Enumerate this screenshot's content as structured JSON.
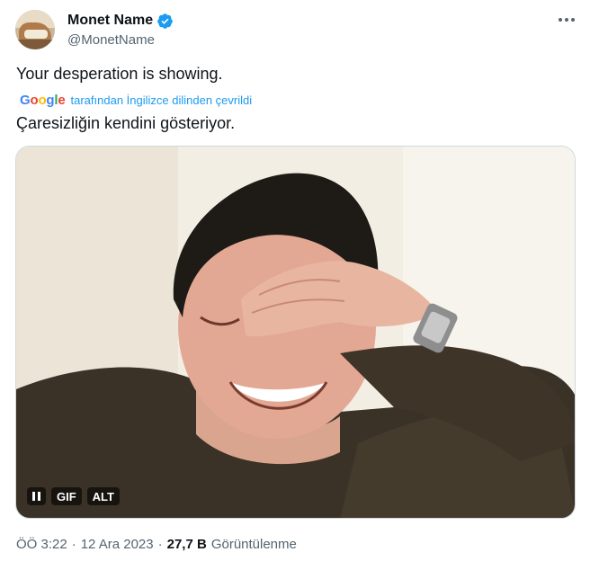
{
  "author": {
    "display_name": "Monet Name",
    "handle": "@MonetName",
    "verified": true,
    "verified_color": "#1d9bf0"
  },
  "tweet": {
    "text": "Your desperation is showing.",
    "translation_provider": "Google",
    "translation_note": "tarafından İngilizce dilinden çevrildi",
    "translated_text": "Çaresizliğin kendini gösteriyor."
  },
  "media": {
    "type": "gif",
    "controls": {
      "pause_icon": "pause-icon",
      "gif_label": "GIF",
      "alt_label": "ALT"
    }
  },
  "meta": {
    "time": "ÖÖ 3:22",
    "separator": "·",
    "date": "12 Ara 2023",
    "views_count": "27,7 B",
    "views_label": "Görüntülenme"
  },
  "icons": {
    "more": "more-horizontal-icon",
    "verified": "verified-badge-icon"
  }
}
